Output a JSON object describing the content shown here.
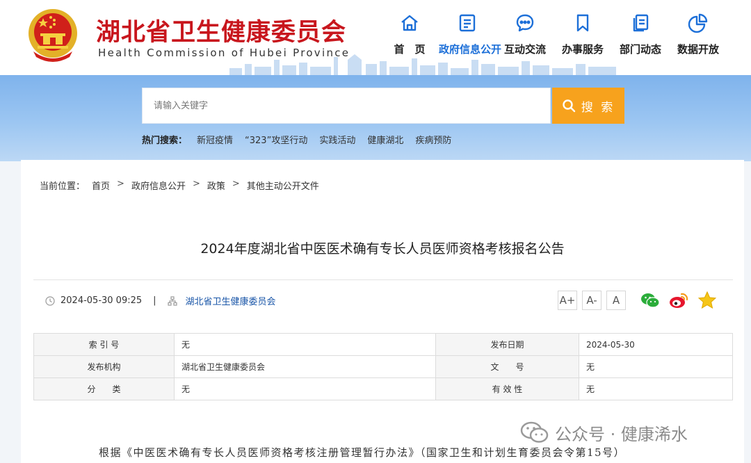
{
  "header": {
    "title": "湖北省卫生健康委员会",
    "subtitle": "Health Commission of Hubei Province",
    "emblem_icon": "national-emblem-icon",
    "brand_color": "#c8161d"
  },
  "nav": {
    "items": [
      {
        "label": "首　页",
        "icon": "home-icon",
        "active": false
      },
      {
        "label": "政府信息公开",
        "icon": "document-icon",
        "active": true
      },
      {
        "label": "互动交流",
        "icon": "chat-icon",
        "active": false
      },
      {
        "label": "办事服务",
        "icon": "bookmark-icon",
        "active": false
      },
      {
        "label": "部门动态",
        "icon": "pages-icon",
        "active": false
      },
      {
        "label": "数据开放",
        "icon": "pie-chart-icon",
        "active": false
      }
    ],
    "active_color": "#1c6fd8"
  },
  "search": {
    "placeholder": "请输入关键字",
    "button_label": "搜 索",
    "button_icon": "search-icon",
    "button_color": "#f7a21d",
    "hot_label": "热门搜索：",
    "hot_items": [
      "新冠疫情",
      "“323”攻坚行动",
      "实践活动",
      "健康湖北",
      "疾病预防"
    ]
  },
  "breadcrumb": {
    "prefix": "当前位置：",
    "items": [
      "首页",
      "政府信息公开",
      "政策",
      "其他主动公开文件"
    ],
    "separator": ">"
  },
  "article": {
    "title": "2024年度湖北省中医医术确有专长人员医师资格考核报名公告",
    "date": "2024-05-30 09:25",
    "divider": "|",
    "source": "湖北省卫生健康委员会",
    "font_buttons": [
      "A+",
      "A-",
      "A"
    ],
    "share_icons": [
      "wechat-icon",
      "weibo-icon",
      "favorite-star-icon"
    ]
  },
  "info_table": [
    {
      "k1": "索 引 号",
      "v1": "无",
      "k2": "发布日期",
      "v2": "2024-05-30"
    },
    {
      "k1": "发布机构",
      "v1": "湖北省卫生健康委员会",
      "k2": "文　　号",
      "v2": "无"
    },
    {
      "k1": "分　　类",
      "v1": "无",
      "k2": "有 效 性",
      "v2": "无"
    }
  ],
  "watermark": "公众号 · 健康浠水",
  "body_text": "根据《中医医术确有专长人员医师资格考核注册管理暂行办法》（国家卫生和计划生育委员会令第15号）"
}
